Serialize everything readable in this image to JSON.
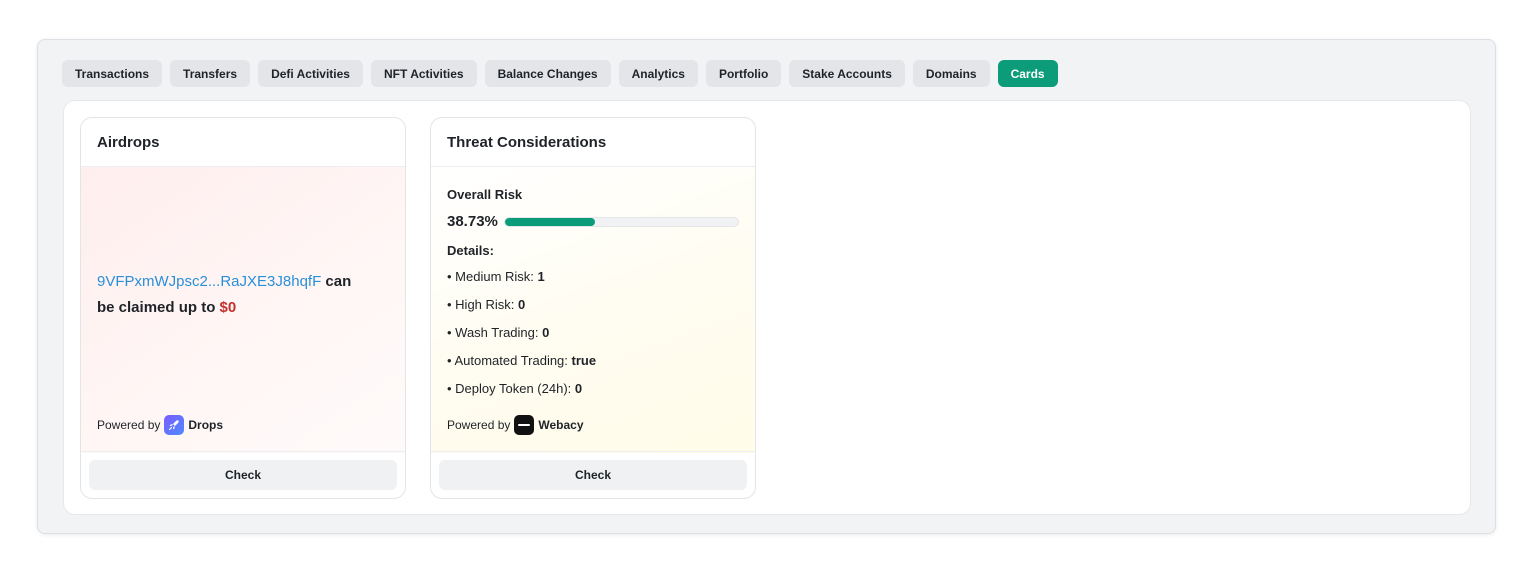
{
  "tabs": [
    {
      "label": "Transactions",
      "active": false
    },
    {
      "label": "Transfers",
      "active": false
    },
    {
      "label": "Defi Activities",
      "active": false
    },
    {
      "label": "NFT Activities",
      "active": false
    },
    {
      "label": "Balance Changes",
      "active": false
    },
    {
      "label": "Analytics",
      "active": false
    },
    {
      "label": "Portfolio",
      "active": false
    },
    {
      "label": "Stake Accounts",
      "active": false
    },
    {
      "label": "Domains",
      "active": false
    },
    {
      "label": "Cards",
      "active": true
    }
  ],
  "colors": {
    "accent": "#0c9c7a",
    "link": "#2a8fd9",
    "amount": "#c4312f"
  },
  "airdrops": {
    "title": "Airdrops",
    "address": "9VFPxmWJpsc2...RaJXE3J8hqfF",
    "claim_text": " can be claimed up to ",
    "amount": "$0",
    "powered_by": "Powered by",
    "brand": "Drops",
    "brand_icon": "drops-rocket-icon",
    "check_label": "Check"
  },
  "threat": {
    "title": "Threat Considerations",
    "overall_label": "Overall Risk",
    "overall_value": "38.73%",
    "overall_percent": 38.73,
    "details_label": "Details:",
    "details": [
      {
        "label": "• Medium Risk: ",
        "value": "1"
      },
      {
        "label": "• High Risk: ",
        "value": "0"
      },
      {
        "label": "• Wash Trading: ",
        "value": "0"
      },
      {
        "label": "• Automated Trading: ",
        "value": "true"
      },
      {
        "label": "• Deploy Token (24h): ",
        "value": "0"
      }
    ],
    "powered_by": "Powered by",
    "brand": "Webacy",
    "brand_icon": "webacy-logo-icon",
    "check_label": "Check"
  }
}
